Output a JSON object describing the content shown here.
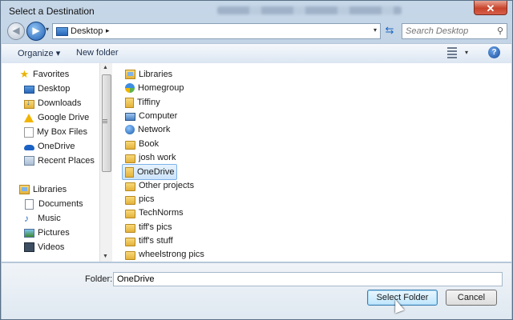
{
  "window": {
    "title": "Select a Destination",
    "close_label": "✕"
  },
  "address_bar": {
    "path": "Desktop",
    "separator": "▸",
    "dropdown": "▾"
  },
  "search": {
    "placeholder": "Search Desktop"
  },
  "toolbar": {
    "organize_label": "Organize ▾",
    "new_folder_label": "New folder",
    "view_dropdown": "▾",
    "help_label": "?"
  },
  "nav_pane": {
    "favorites_header": "Favorites",
    "favorites": [
      {
        "label": "Desktop",
        "icon": "desktop-icon"
      },
      {
        "label": "Downloads",
        "icon": "downloads-icon"
      },
      {
        "label": "Google Drive",
        "icon": "google-drive-icon"
      },
      {
        "label": "My Box Files",
        "icon": "box-files-icon"
      },
      {
        "label": "OneDrive",
        "icon": "onedrive-icon"
      },
      {
        "label": "Recent Places",
        "icon": "recent-places-icon"
      }
    ],
    "libraries_header": "Libraries",
    "libraries": [
      {
        "label": "Documents",
        "icon": "documents-icon"
      },
      {
        "label": "Music",
        "icon": "music-icon"
      },
      {
        "label": "Pictures",
        "icon": "pictures-icon"
      },
      {
        "label": "Videos",
        "icon": "videos-icon"
      }
    ]
  },
  "file_list": {
    "items": [
      {
        "label": "Libraries",
        "icon": "libraries-icon"
      },
      {
        "label": "Homegroup",
        "icon": "homegroup-icon"
      },
      {
        "label": "Tiffiny",
        "icon": "user-folder-icon"
      },
      {
        "label": "Computer",
        "icon": "computer-icon"
      },
      {
        "label": "Network",
        "icon": "network-icon"
      },
      {
        "label": "Book",
        "icon": "folder-icon"
      },
      {
        "label": "josh work",
        "icon": "folder-icon"
      },
      {
        "label": "OneDrive",
        "icon": "onedrive-folder-icon",
        "selected": true
      },
      {
        "label": "Other projects",
        "icon": "folder-icon"
      },
      {
        "label": "pics",
        "icon": "folder-icon"
      },
      {
        "label": "TechNorms",
        "icon": "folder-icon"
      },
      {
        "label": "tiff's pics",
        "icon": "folder-icon"
      },
      {
        "label": "tiff's stuff",
        "icon": "folder-icon"
      },
      {
        "label": "wheelstrong pics",
        "icon": "folder-icon"
      }
    ]
  },
  "footer": {
    "folder_label": "Folder:",
    "folder_value": "OneDrive",
    "select_label": "Select Folder",
    "cancel_label": "Cancel"
  },
  "colors": {
    "accent": "#1d65c1",
    "selection": "#cce4fa",
    "folder": "#e3b23c"
  }
}
